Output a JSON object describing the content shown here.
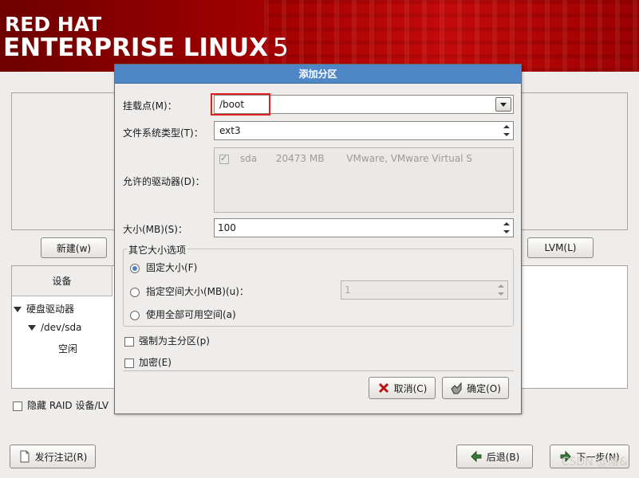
{
  "header": {
    "brand_line1": "RED HAT",
    "brand_line2": "ENTERPRISE LINUX",
    "version": "5"
  },
  "background": {
    "new_button": "新建(w)",
    "lvm_button": "LVM(L)",
    "device_column": "设备",
    "tree": [
      {
        "label": "硬盘驱动器"
      },
      {
        "label": "/dev/sda"
      },
      {
        "label": "空闲"
      }
    ],
    "hide_raid_label": "隐藏 RAID 设备/LV",
    "release_notes_button": "发行注记(R)",
    "back_button": "后退(B)",
    "next_button": "下一步(N)"
  },
  "dialog": {
    "title": "添加分区",
    "mount_point_label": "挂载点(M)：",
    "mount_point_value": "/boot",
    "fs_type_label": "文件系统类型(T)：",
    "fs_type_value": "ext3",
    "drives_label": "允许的驱动器(D)：",
    "drives": [
      {
        "name": "sda",
        "size": "20473 MB",
        "model": "VMware, VMware Virtual S",
        "checked": true
      }
    ],
    "size_label": "大小(MB)(S)：",
    "size_value": "100",
    "size_options_legend": "其它大小选项",
    "option_fixed": "固定大小(F)",
    "option_maxsize": "指定空间大小(MB)(u)：",
    "maxsize_value": "1",
    "option_fill": "使用全部可用空间(a)",
    "force_primary": "强制为主分区(p)",
    "encrypt": "加密(E)",
    "cancel_button": "取消(C)",
    "ok_button": "确定(O)"
  },
  "watermark": "CSDN @雕&"
}
